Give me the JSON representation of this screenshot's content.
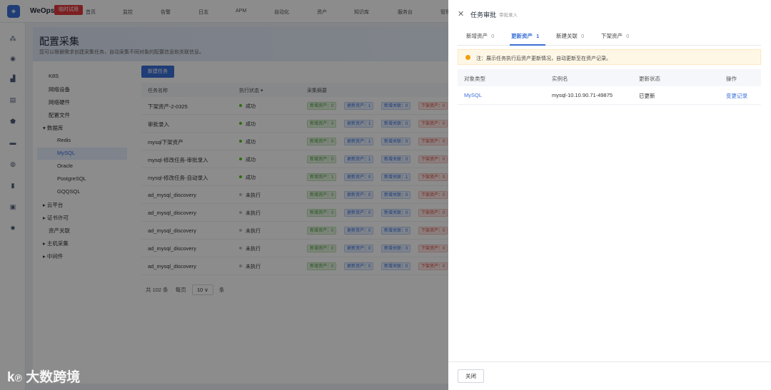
{
  "app": {
    "brand": "WeOps",
    "trial": "临时试用"
  },
  "nav": [
    "首页",
    "监控",
    "告警",
    "日志",
    "APM",
    "自动化",
    "资产",
    "知识库",
    "服务台",
    "管理"
  ],
  "page": {
    "title": "配置采集",
    "desc": "您可以根据需求创建采集任务，自动采集不同对象的配置信息和关联信息。"
  },
  "tree": [
    "K8S",
    "网络设备",
    "网络硬件",
    "配置文件",
    "▾ 数据库",
    "Redis",
    "MySQL",
    "Oracle",
    "PostgreSQL",
    "GQQSQL",
    "▸ 云平台",
    "▸ 证书许可",
    "资产关联",
    "▸ 主机采集",
    "▸ 中间件"
  ],
  "new_task": "新建任务",
  "table": {
    "headers": [
      "任务名称",
      "执行状态 ▾",
      "采集摘要"
    ],
    "rows": [
      {
        "name": "下架资产-2-0325",
        "status": "成功",
        "ok": true,
        "tags": [
          "新增资产：0",
          "更新资产：1",
          "新增关联：0",
          "下架资产：0"
        ]
      },
      {
        "name": "审批录入",
        "status": "成功",
        "ok": true,
        "tags": [
          "新增资产：0",
          "更新资产：1",
          "新增关联：0",
          "下架资产：0"
        ]
      },
      {
        "name": "mysql下架资产",
        "status": "成功",
        "ok": true,
        "tags": [
          "新增资产：0",
          "更新资产：1",
          "新增关联：0",
          "下架资产：0"
        ]
      },
      {
        "name": "mysql-修改任务-审批录入",
        "status": "成功",
        "ok": true,
        "tags": [
          "新增资产：0",
          "更新资产：1",
          "新增关联：0",
          "下架资产：0"
        ]
      },
      {
        "name": "mysql-修改任务-自动录入",
        "status": "成功",
        "ok": true,
        "tags": [
          "新增资产：1",
          "更新资产：0",
          "新增关联：1",
          "下架资产：0"
        ]
      },
      {
        "name": "ad_mysql_discovery",
        "status": "未执行",
        "ok": false,
        "tags": [
          "新增资产：0",
          "更新资产：0",
          "新增关联：0",
          "下架资产：0"
        ]
      },
      {
        "name": "ad_mysql_discovery",
        "status": "未执行",
        "ok": false,
        "tags": [
          "新增资产：0",
          "更新资产：0",
          "新增关联：0",
          "下架资产：0"
        ]
      },
      {
        "name": "ad_mysql_discovery",
        "status": "未执行",
        "ok": false,
        "tags": [
          "新增资产：0",
          "更新资产：0",
          "新增关联：0",
          "下架资产：0"
        ]
      },
      {
        "name": "ad_mysql_discovery",
        "status": "未执行",
        "ok": false,
        "tags": [
          "新增资产：0",
          "更新资产：0",
          "新增关联：0",
          "下架资产：0"
        ]
      },
      {
        "name": "ad_mysql_discovery",
        "status": "未执行",
        "ok": false,
        "tags": [
          "新增资产：0",
          "更新资产：0",
          "新增关联：0",
          "下架资产：0"
        ]
      }
    ]
  },
  "pager": {
    "total": "共 102 条",
    "per_page_label": "每页",
    "per_page": "10 ∨",
    "unit": "条"
  },
  "watermark": "大数跨境",
  "drawer": {
    "title": "任务审批",
    "subtitle": "审批录入",
    "tabs": [
      {
        "label": "新增资产",
        "count": "0"
      },
      {
        "label": "更新资产",
        "count": "1"
      },
      {
        "label": "新建关联",
        "count": "0"
      },
      {
        "label": "下架资产",
        "count": "0"
      }
    ],
    "note": "注：展示任务执行后资产更新情况，自动更新至在资产记录。",
    "headers": [
      "对象类型",
      "实例名",
      "更新状态",
      "操作"
    ],
    "row": {
      "type": "MySQL",
      "instance": "mysql-10.10.90.71-49875",
      "status": "已更新",
      "action": "变更记录"
    },
    "close": "关闭"
  },
  "colors": {
    "accent": "#3a6fd8",
    "success": "#52c41a",
    "warning": "#f59e0b"
  }
}
